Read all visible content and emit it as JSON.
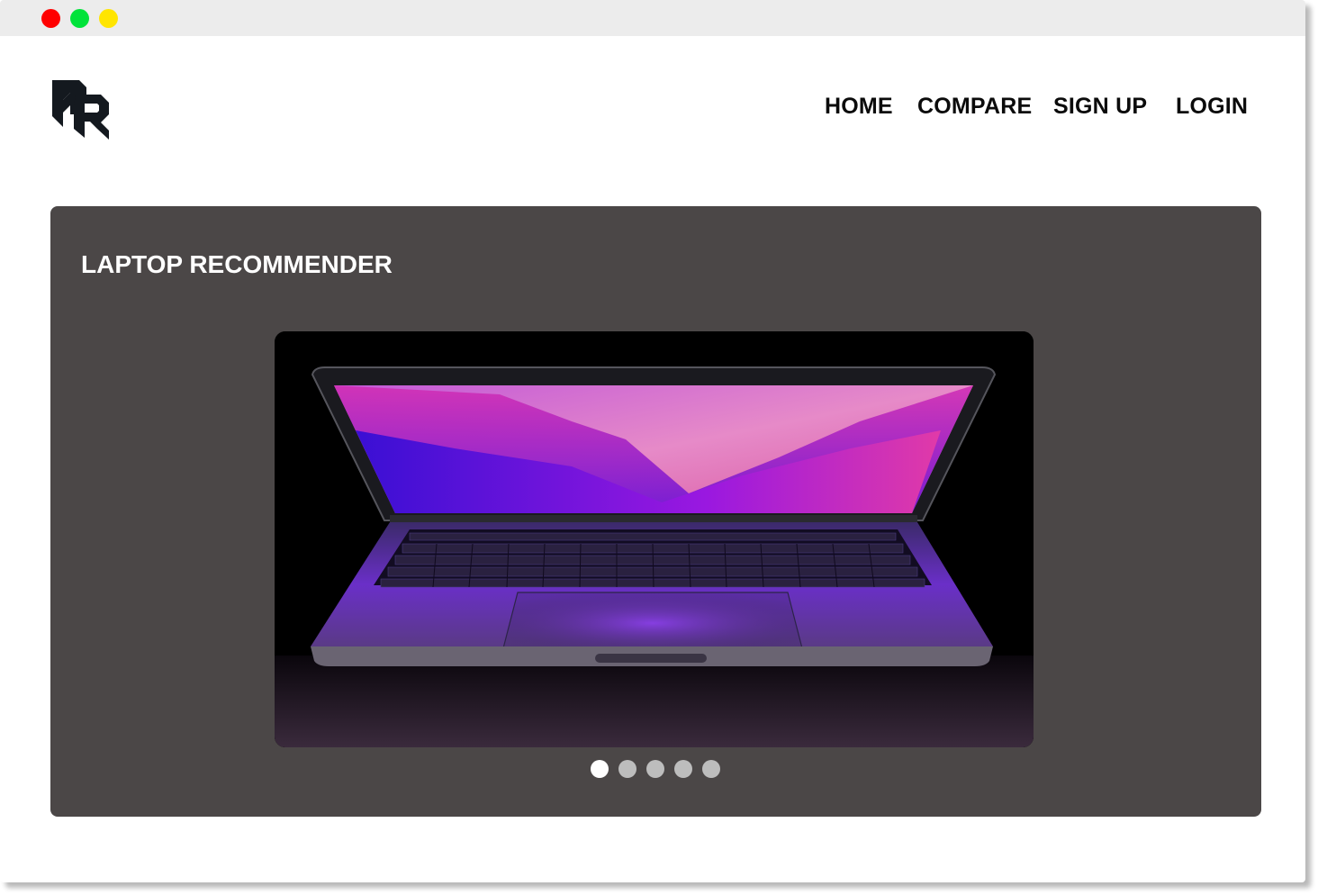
{
  "brand": {
    "logo": "pr-logo-icon"
  },
  "nav": {
    "items": [
      {
        "label": "HOME"
      },
      {
        "label": "COMPARE"
      },
      {
        "label": "SIGN UP"
      },
      {
        "label": "LOGIN"
      }
    ]
  },
  "hero": {
    "title": "LAPTOP RECOMMENDER",
    "slide_image": "laptop-photo",
    "carousel": {
      "slide_count": 5,
      "active_index": 0
    }
  },
  "colors": {
    "hero_background": "#4b4747",
    "dot_active": "#ffffff",
    "dot_inactive": "#bdbdbd"
  }
}
